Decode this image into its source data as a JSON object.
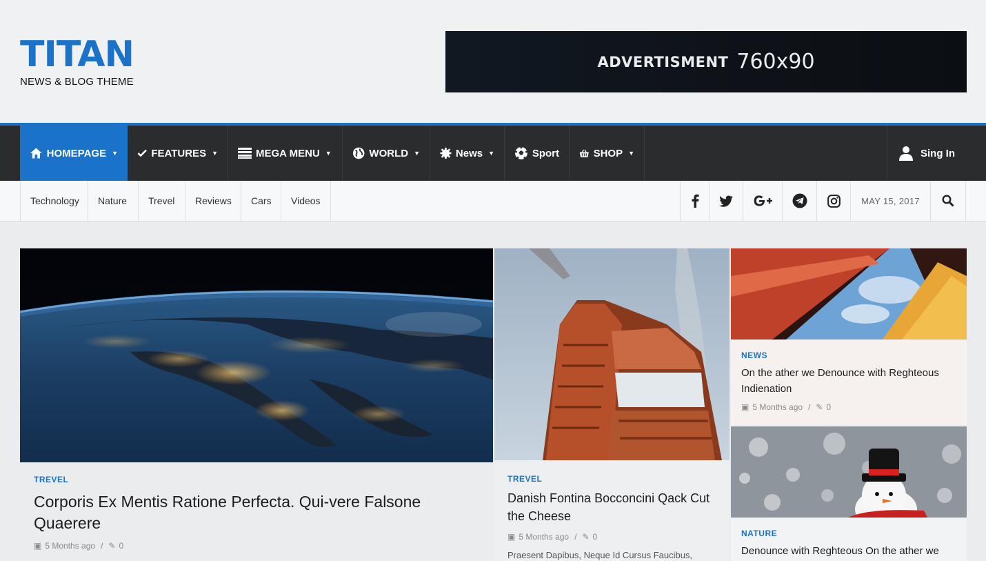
{
  "header": {
    "logo_title": "TITAN",
    "logo_tagline": "NEWS & BLOG THEME",
    "ad_text": "ADVERTISMENT",
    "ad_size": "760x90"
  },
  "nav": {
    "items": [
      {
        "label": "HOMEPAGE",
        "icon": "home-icon",
        "dropdown": true
      },
      {
        "label": "FEATURES",
        "icon": "check-icon",
        "dropdown": true
      },
      {
        "label": "MEGA MENU",
        "icon": "list-icon",
        "dropdown": true
      },
      {
        "label": "WORLD",
        "icon": "globe-icon",
        "dropdown": true
      },
      {
        "label": "News",
        "icon": "gear-icon",
        "dropdown": true
      },
      {
        "label": "Sport",
        "icon": "soccer-ball-icon",
        "dropdown": false
      },
      {
        "label": "SHOP",
        "icon": "basket-icon",
        "dropdown": true
      }
    ],
    "signin_label": "Sing In",
    "caret": "▼"
  },
  "subnav": {
    "items": [
      "Technology",
      "Nature",
      "Trevel",
      "Reviews",
      "Cars",
      "Videos"
    ],
    "social": [
      "facebook-icon",
      "twitter-icon",
      "google-plus-icon",
      "telegram-icon",
      "instagram-icon",
      "search-icon"
    ],
    "date": "MAY 15, 2017"
  },
  "cards": [
    {
      "category": "TREVEL",
      "title": "Corporis Ex Mentis Ratione Perfecta. Qui-vere Falsone Quaerere",
      "time": "5 Months ago",
      "comments": "0"
    },
    {
      "category": "TREVEL",
      "title": "Danish Fontina Bocconcini Qack Cut the Cheese",
      "time": "5 Months ago",
      "comments": "0",
      "excerpt": "Praesent Dapibus, Neque Id Cursus Faucibus, Tortor"
    },
    {
      "category": "NEWS",
      "title": "On the ather we Denounce with Reghteous Indienation",
      "time": "5 Months ago",
      "comments": "0"
    },
    {
      "category": "NATURE",
      "title": "Denounce with Reghteous On the ather we"
    }
  ],
  "meta_separator": "/",
  "colors": {
    "accent": "#1a73c8",
    "nav_bg": "#2b2c2e"
  }
}
